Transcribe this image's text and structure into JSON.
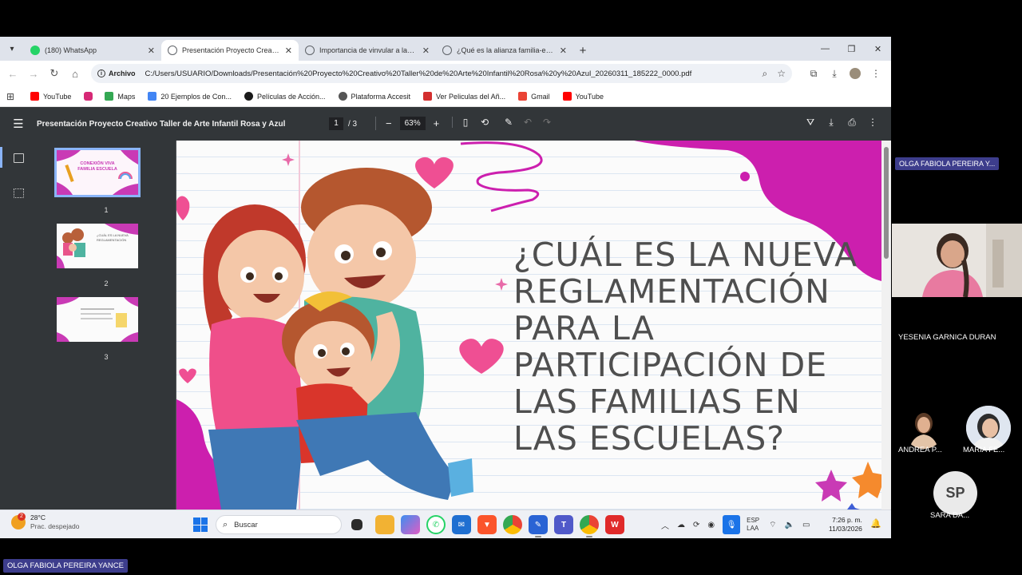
{
  "browser": {
    "tabs": [
      {
        "label": "(180) WhatsApp",
        "icon": "whatsapp-icon",
        "color": "#25d366",
        "active": false
      },
      {
        "label": "Presentación Proyecto Creativo",
        "icon": "globe-icon",
        "color": "#5f6368",
        "active": true
      },
      {
        "label": "Importancia de vinvular a las fa",
        "icon": "globe-icon",
        "color": "#5f6368",
        "active": false
      },
      {
        "label": "¿Qué es la alianza familia-escue",
        "icon": "globe-icon",
        "color": "#5f6368",
        "active": false
      }
    ],
    "address": {
      "chip": "Archivo",
      "url": "C:/Users/USUARIO/Downloads/Presentación%20Proyecto%20Creativo%20Taller%20de%20Arte%20Infantil%20Rosa%20y%20Azul_20260311_185222_0000.pdf"
    },
    "bookmarks": [
      {
        "label": "YouTube",
        "icon": "youtube-icon",
        "color": "#ff0000"
      },
      {
        "label": "",
        "icon": "instagram-icon",
        "color": "#d62976"
      },
      {
        "label": "Maps",
        "icon": "maps-icon",
        "color": "#34a853"
      },
      {
        "label": "20 Ejemplos de Con...",
        "icon": "bookmark-icon",
        "color": "#4285f4"
      },
      {
        "label": "Películas de Acción...",
        "icon": "bookmark-icon",
        "color": "#1a1a1a"
      },
      {
        "label": "Plataforma Accesit",
        "icon": "bookmark-icon",
        "color": "#555555"
      },
      {
        "label": "Ver Peliculas del Añ...",
        "icon": "bookmark-icon",
        "color": "#d32f2f"
      },
      {
        "label": "Gmail",
        "icon": "gmail-icon",
        "color": "#ea4335"
      },
      {
        "label": "YouTube",
        "icon": "youtube-icon",
        "color": "#ff0000"
      }
    ]
  },
  "pdf": {
    "title": "Presentación Proyecto Creativo Taller de Arte Infantil Rosa y Azul",
    "current_page": "1",
    "total_pages": "/  3",
    "zoom": "63%",
    "thumbnails": [
      {
        "num": "1",
        "title": "CONEXIÓN VIVA FAMILIA ESCUELA"
      },
      {
        "num": "2",
        "title": "¿CUÁL ES LA NUEVA REGLAMENTACIÓN"
      },
      {
        "num": "3",
        "title": ""
      }
    ],
    "slide_title": "¿Cuál es la nueva reglamentación para la participación de las familias en las escuelas?"
  },
  "taskbar": {
    "weather_temp": "28°C",
    "weather_desc": "Prac. despejado",
    "weather_badge": "2",
    "search_placeholder": "Buscar",
    "lang_line1": "ESP",
    "lang_line2": "LAA",
    "time": "7:26 p. m.",
    "date": "11/03/2026"
  },
  "meeting": {
    "presenter_chip": "OLGA FABIOLA PEREIRA Y...",
    "participant_yesenia": "YESENIA GARNICA DURAN",
    "participant_andrea": "ANDREA P...",
    "participant_maria": "MARIA FE...",
    "participant_sara_initials": "SP",
    "participant_sara": "SARA DA...",
    "bottom_chip": "OLGA FABIOLA PEREIRA YANCE"
  }
}
